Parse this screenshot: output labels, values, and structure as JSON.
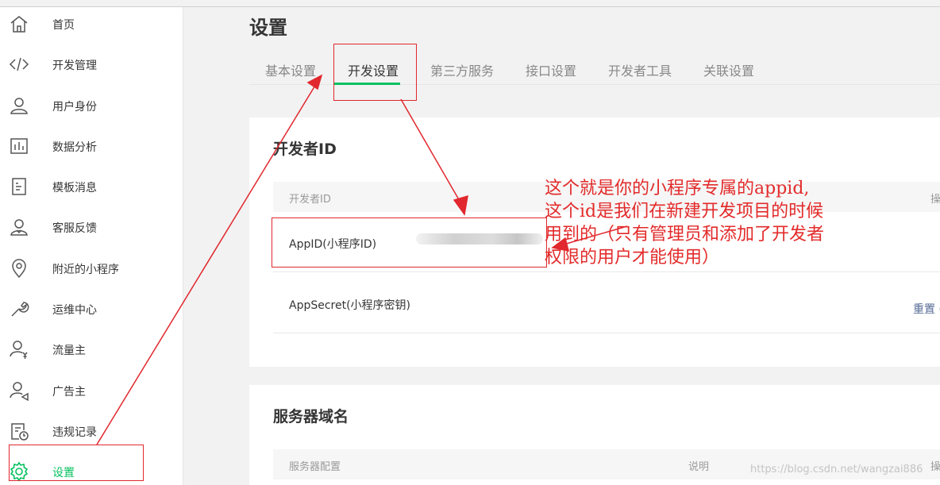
{
  "sidebar": {
    "items": [
      {
        "label": "首页",
        "icon": "home-icon"
      },
      {
        "label": "开发管理",
        "icon": "code-icon"
      },
      {
        "label": "用户身份",
        "icon": "user-icon"
      },
      {
        "label": "数据分析",
        "icon": "bar-chart-icon"
      },
      {
        "label": "模板消息",
        "icon": "document-icon"
      },
      {
        "label": "客服反馈",
        "icon": "service-user-icon"
      },
      {
        "label": "附近的小程序",
        "icon": "location-pin-icon"
      },
      {
        "label": "运维中心",
        "icon": "wrench-icon"
      },
      {
        "label": "流量主",
        "icon": "user-yen-icon"
      },
      {
        "label": "广告主",
        "icon": "user-megaphone-icon"
      },
      {
        "label": "违规记录",
        "icon": "clipboard-clock-icon"
      },
      {
        "label": "设置",
        "icon": "gear-icon",
        "active": true
      }
    ]
  },
  "main": {
    "title": "设置",
    "tabs": [
      {
        "label": "基本设置"
      },
      {
        "label": "开发设置",
        "active": true
      },
      {
        "label": "第三方服务"
      },
      {
        "label": "接口设置"
      },
      {
        "label": "开发者工具"
      },
      {
        "label": "关联设置"
      }
    ],
    "developer_card": {
      "title": "开发者ID",
      "header": {
        "col1": "开发者ID",
        "col3": "操"
      },
      "rows": [
        {
          "label": "AppID(小程序ID)",
          "value_redacted": true
        },
        {
          "label": "AppSecret(小程序密钥)",
          "action": "重置 ("
        }
      ]
    },
    "server_card": {
      "title": "服务器域名",
      "header": {
        "col1": "服务器配置",
        "col2": "说明",
        "col3": "操"
      }
    }
  },
  "annotation": {
    "lines": [
      "这个就是你的小程序专属的appid,",
      "这个id是我们在新建开发项目的时候",
      "用到的（只有管理员和添加了开发者",
      "权限的用户才能使用）"
    ],
    "color": "#e32b2b"
  },
  "watermark": "https://blog.csdn.net/wangzai886",
  "colors": {
    "accent": "#07c160",
    "link": "#576b95"
  }
}
